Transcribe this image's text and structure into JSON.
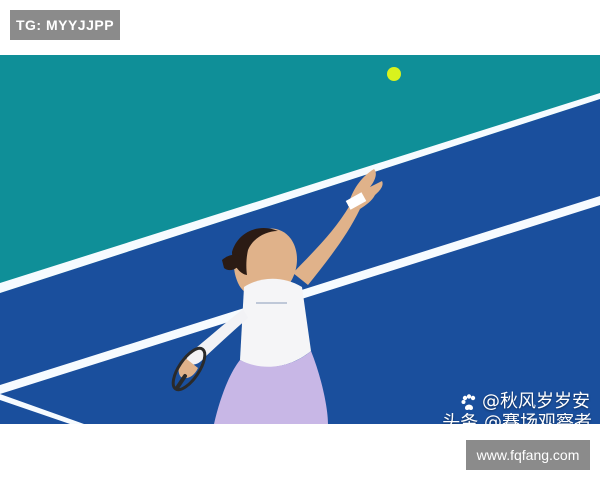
{
  "top_badge": {
    "text": "TG: MYYJJPP"
  },
  "photo": {
    "description_alt": "Tennis player serving on a blue hard court",
    "colors": {
      "court_upper": "#0f8f98",
      "court_main": "#1a4f9d",
      "court_lines": "#f6fbff",
      "top_white": "#ffffff",
      "bottom_white": "#ffffff",
      "ball": "#d9f21d",
      "skin": "#e0b28a",
      "top": "#f5f5f7",
      "skirt": "#c8b7e6",
      "sleeve": "#f2f2f5",
      "hair": "#2b1b14",
      "racket": "#2a2a2a"
    },
    "watermark": {
      "primary": "@秋风岁岁安",
      "secondary": "头条 @赛场观察者"
    }
  },
  "bottom_badge": {
    "text": "www.fqfang.com"
  }
}
